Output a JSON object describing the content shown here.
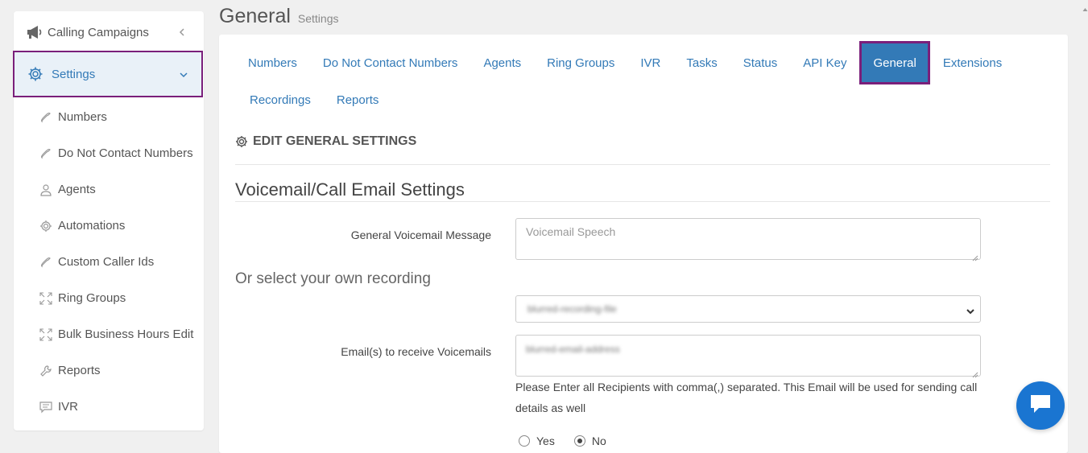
{
  "sidebar": {
    "campaigns_label": "Calling Campaigns",
    "settings_label": "Settings",
    "items": [
      {
        "label": "Numbers",
        "icon": "phone-icon"
      },
      {
        "label": "Do Not Contact Numbers",
        "icon": "phone-icon"
      },
      {
        "label": "Agents",
        "icon": "user-icon"
      },
      {
        "label": "Automations",
        "icon": "gear-icon"
      },
      {
        "label": "Custom Caller Ids",
        "icon": "phone-icon"
      },
      {
        "label": "Ring Groups",
        "icon": "expand-icon"
      },
      {
        "label": "Bulk Business Hours Edit",
        "icon": "expand-icon"
      },
      {
        "label": "Reports",
        "icon": "wrench-icon"
      },
      {
        "label": "IVR",
        "icon": "message-icon"
      }
    ]
  },
  "header": {
    "title": "General",
    "subtitle": "Settings"
  },
  "tabs": {
    "row1": [
      "Numbers",
      "Do Not Contact Numbers",
      "Agents",
      "Ring Groups",
      "IVR",
      "Tasks",
      "Status",
      "API Key",
      "General",
      "Extensions"
    ],
    "row2": [
      "Recordings",
      "Reports"
    ],
    "active": "General"
  },
  "form": {
    "section_title": "EDIT GENERAL SETTINGS",
    "subsection_title": "Voicemail/Call Email Settings",
    "voicemail_label": "General Voicemail Message",
    "voicemail_placeholder": "Voicemail Speech",
    "alt_recording_text": "Or select your own recording",
    "recording_selected": "blurred-recording-file",
    "emails_label": "Email(s) to receive Voicemails",
    "emails_value": "blurred-email-address",
    "help_text": "Please Enter all Recipients with comma(,) separated. This Email will be used for sending call details as well",
    "radio_yes": "Yes",
    "radio_no": "No",
    "radio_selected": "No"
  },
  "colors": {
    "accent": "#337ab7",
    "highlight_border": "#7a1f7a",
    "chat_button": "#1a75d1"
  }
}
